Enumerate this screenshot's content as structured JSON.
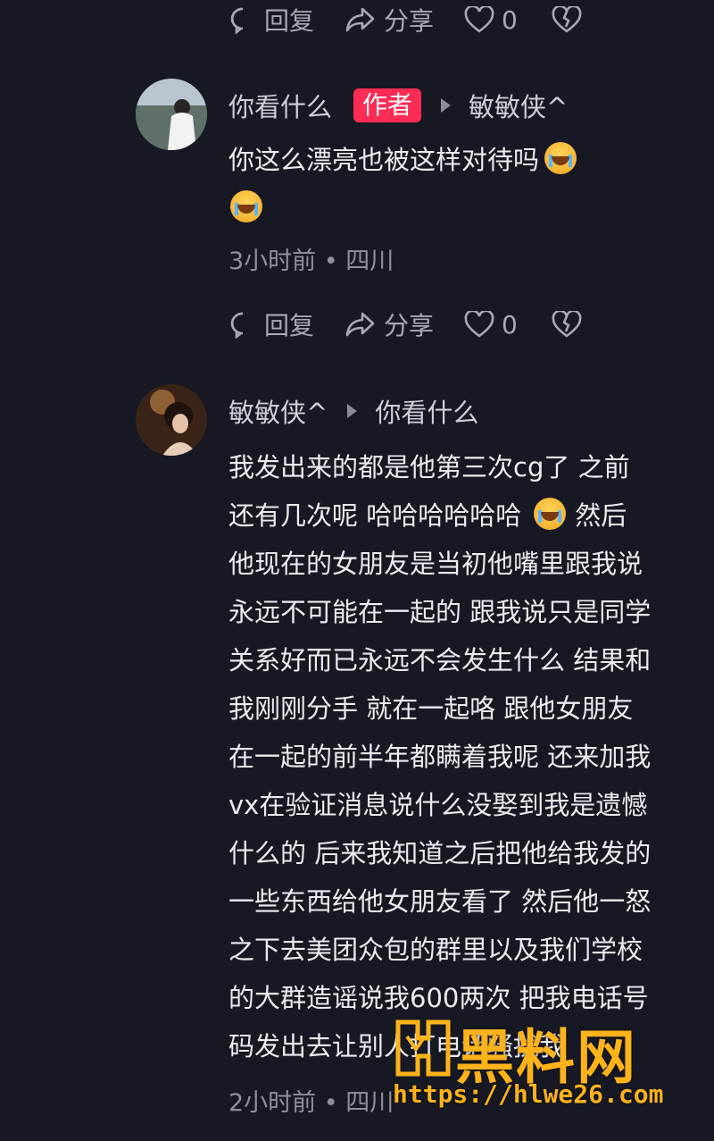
{
  "actions": {
    "reply": "回复",
    "share": "分享",
    "like_count": "0"
  },
  "comments": [
    {
      "user": "你看什么",
      "badge": "作者",
      "reply_to": "敏敏侠^",
      "text_line1": "你这么漂亮也被这样对待吗",
      "meta": "3小时前 • 四川"
    },
    {
      "user": "敏敏侠^",
      "reply_to": "你看什么",
      "lines": [
        "我发出来的都是他第三次cg了 之前",
        "还有几次呢 哈哈哈哈哈哈",
        "然后",
        "他现在的女朋友是当初他嘴里跟我说",
        "永远不可能在一起的 跟我说只是同学",
        "关系好而已永远不会发生什么 结果和",
        "我刚刚分手 就在一起咯 跟他女朋友",
        "在一起的前半年都瞒着我呢 还来加我",
        "vx在验证消息说什么没娶到我是遗憾",
        "什么的 后来我知道之后把他给我发的",
        "一些东西给他女朋友看了 然后他一怒",
        "之下去美团众包的群里以及我们学校",
        "的大群造谣说我600两次 把我电话号",
        "码发出去让别人打电话骚扰我"
      ],
      "meta": "2小时前 • 四川"
    }
  ],
  "watermark": {
    "title": "黑料网",
    "url": "https://hlwe26.com"
  },
  "colors": {
    "background": "#161823",
    "badge": "#fe2c55",
    "watermark": "#ffb31a"
  }
}
